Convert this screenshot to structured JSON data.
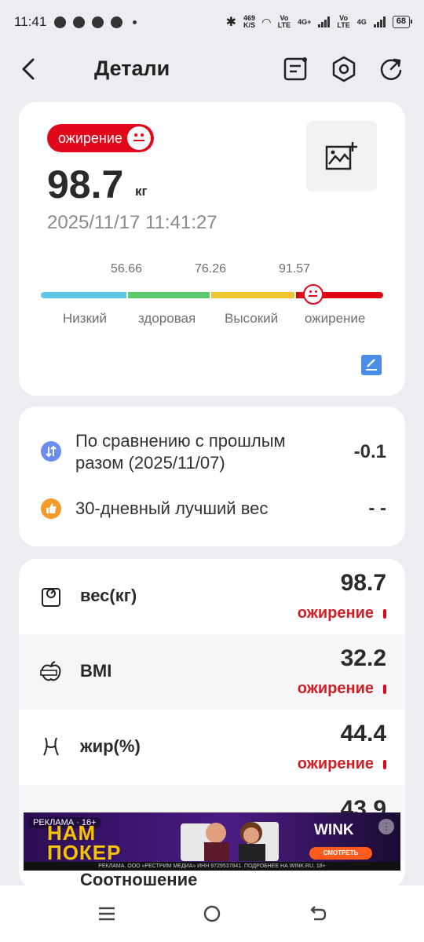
{
  "status_bar": {
    "time": "11:41",
    "speed": "469",
    "speed_unit": "K/S",
    "net1_top": "Vo",
    "net1_bottom": "LTE",
    "net2": "4G+",
    "net3_top": "Vo",
    "net3_bottom": "LTE",
    "net4": "4G",
    "battery": "68"
  },
  "header": {
    "title": "Детали",
    "icons": [
      "back-icon",
      "report-icon",
      "settings-hex-icon",
      "refresh-icon"
    ]
  },
  "summary": {
    "badge": "ожирение",
    "weight": "98.7",
    "unit": "кг",
    "datetime": "2025/11/17 11:41:27",
    "thresholds": [
      "56.66",
      "76.26",
      "91.57"
    ],
    "zones": [
      "Низкий",
      "здоровая",
      "Высокий",
      "ожирение"
    ],
    "zone_colors": [
      "#5ec6e8",
      "#5cc96a",
      "#f1c232",
      "#e2061b"
    ],
    "level_value": 98.7
  },
  "compare": {
    "rows": [
      {
        "label": "По сравнению с прошлым разом (2025/11/07)",
        "value": "-0.1",
        "icon": "compare-arrows-icon",
        "color": "#6b8cf0"
      },
      {
        "label": "30-дневный лучший вес",
        "value": "- -",
        "icon": "thumbs-up-icon",
        "color": "#f49a2b"
      }
    ]
  },
  "metrics": [
    {
      "label": "вес(кг)",
      "value": "98.7",
      "status": "ожирение",
      "icon": "scale-icon"
    },
    {
      "label": "BMI",
      "value": "32.2",
      "status": "ожирение",
      "icon": "apple-tape-icon"
    },
    {
      "label": "жир(%)",
      "value": "44.4",
      "status": "ожирение",
      "icon": "waist-icon"
    },
    {
      "label": "",
      "value": "43.9",
      "status": "",
      "icon": ""
    }
  ],
  "next_label": "Соотношение",
  "ad": {
    "tag": "РЕКЛАМА · 16+",
    "brand_line1": "НАМ",
    "brand_line2": "ПОКЕР",
    "wink": "WINK",
    "button": "СМОТРЕТЬ",
    "legal": "РЕКЛАМА. ООО «РЕСТРИМ МЕДИА» ИНН 9729537841. ПОДРОБНЕЕ НА WINK.RU. 18+"
  },
  "nav": [
    "menu-icon",
    "home-circle-icon",
    "back-arrow-icon"
  ]
}
